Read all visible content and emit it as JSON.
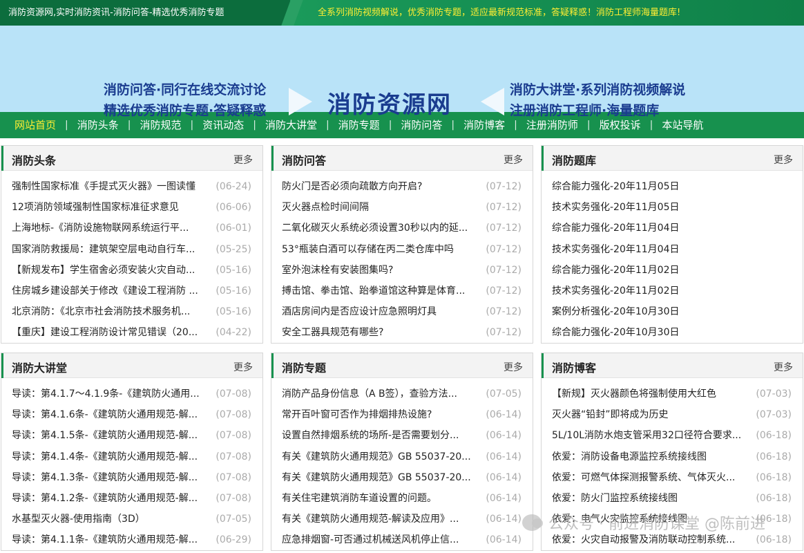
{
  "topbar": {
    "left": "消防资源网,实时消防资讯-消防问答-精选优秀消防专题",
    "right": "全系列消防视频解说，优秀消防专题，适应最新规范标准，答疑释惑！消防工程师海量题库!"
  },
  "banner": {
    "left_line1": "消防问答·同行在线交流讨论",
    "left_line2": "精选优秀消防专题·答疑释惑",
    "logo": "消防资源网",
    "right_line1": "消防大讲堂·系列消防视频解说",
    "right_line2": "注册消防工程师·海量题库"
  },
  "nav": [
    "网站首页",
    "消防头条",
    "消防规范",
    "资讯动态",
    "消防大讲堂",
    "消防专题",
    "消防问答",
    "消防博客",
    "注册消防师",
    "版权投诉",
    "本站导航"
  ],
  "more_label": "更多",
  "panels": [
    {
      "title": "消防头条",
      "items": [
        {
          "t": "强制性国家标准《手提式灭火器》一图读懂",
          "d": "(06-24)"
        },
        {
          "t": "12项消防领域强制性国家标准征求意见",
          "d": "(06-06)"
        },
        {
          "t": "上海地标-《消防设施物联网系统运行平...",
          "d": "(06-01)"
        },
        {
          "t": "国家消防救援局：建筑架空层电动自行车...",
          "d": "(05-25)"
        },
        {
          "t": "【新规发布】学生宿舍必须安装火灾自动...",
          "d": "(05-16)"
        },
        {
          "t": "住房城乡建设部关于修改《建设工程消防 ...",
          "d": "(05-16)"
        },
        {
          "t": "北京消防：《北京市社会消防技术服务机...",
          "d": "(05-16)"
        },
        {
          "t": "【重庆】建设工程消防设计常见错误（20...",
          "d": "(04-22)"
        }
      ]
    },
    {
      "title": "消防问答",
      "items": [
        {
          "t": "防火门是否必须向疏散方向开启?",
          "d": "(07-12)"
        },
        {
          "t": "灭火器点检时间间隔",
          "d": "(07-12)"
        },
        {
          "t": "二氧化碳灭火系统必须设置30秒以内的延...",
          "d": "(07-12)"
        },
        {
          "t": "53°瓶装白酒可以存储在丙二类仓库中吗",
          "d": "(07-12)"
        },
        {
          "t": "室外泡沫栓有安装图集吗?",
          "d": "(07-12)"
        },
        {
          "t": "搏击馆、拳击馆、跆拳道馆这种算是体育...",
          "d": "(07-12)"
        },
        {
          "t": "酒店房间内是否应设计应急照明灯具",
          "d": "(07-12)"
        },
        {
          "t": "安全工器具规范有哪些?",
          "d": "(07-12)"
        }
      ]
    },
    {
      "title": "消防题库",
      "items": [
        {
          "t": "综合能力强化-20年11月05日",
          "d": ""
        },
        {
          "t": "技术实务强化-20年11月05日",
          "d": ""
        },
        {
          "t": "综合能力强化-20年11月04日",
          "d": ""
        },
        {
          "t": "技术实务强化-20年11月04日",
          "d": ""
        },
        {
          "t": "综合能力强化-20年11月02日",
          "d": ""
        },
        {
          "t": "技术实务强化-20年11月02日",
          "d": ""
        },
        {
          "t": "案例分析强化-20年10月30日",
          "d": ""
        },
        {
          "t": "综合能力强化-20年10月30日",
          "d": ""
        }
      ]
    },
    {
      "title": "消防大讲堂",
      "items": [
        {
          "t": "导读：第4.1.7～4.1.9条-《建筑防火通用...",
          "d": "(07-08)"
        },
        {
          "t": "导读：第4.1.6条-《建筑防火通用规范-解...",
          "d": "(07-08)"
        },
        {
          "t": "导读：第4.1.5条-《建筑防火通用规范-解...",
          "d": "(07-08)"
        },
        {
          "t": "导读：第4.1.4条-《建筑防火通用规范-解...",
          "d": "(07-08)"
        },
        {
          "t": "导读：第4.1.3条-《建筑防火通用规范-解...",
          "d": "(07-08)"
        },
        {
          "t": "导读：第4.1.2条-《建筑防火通用规范-解...",
          "d": "(07-08)"
        },
        {
          "t": "水基型灭火器-使用指南（3D）",
          "d": "(07-05)"
        },
        {
          "t": "导读：第4.1.1条-《建筑防火通用规范-解...",
          "d": "(06-29)"
        }
      ]
    },
    {
      "title": "消防专题",
      "items": [
        {
          "t": "消防产品身份信息（A B签），查验方法...",
          "d": "(07-05)"
        },
        {
          "t": "常开百叶窗可否作为排烟排热设施?",
          "d": "(06-14)"
        },
        {
          "t": "设置自然排烟系统的场所-是否需要划分...",
          "d": "(06-14)"
        },
        {
          "t": "有关《建筑防火通用规范》GB 55037-20...",
          "d": "(06-14)"
        },
        {
          "t": "有关《建筑防火通用规范》GB 55037-20...",
          "d": "(06-14)"
        },
        {
          "t": "有关住宅建筑消防车道设置的问题。",
          "d": "(06-14)"
        },
        {
          "t": "有关《建筑防火通用规范-解读及应用》...",
          "d": "(06-14)"
        },
        {
          "t": "应急排烟窗-可否通过机械送风机停止信...",
          "d": "(06-14)"
        }
      ]
    },
    {
      "title": "消防博客",
      "items": [
        {
          "t": "【新规】灭火器颜色将强制使用大红色",
          "d": "(07-03)"
        },
        {
          "t": "灭火器“铅封”即将成为历史",
          "d": "(07-03)"
        },
        {
          "t": "5L/10L消防水炮支管采用32口径符合要求...",
          "d": "(06-18)"
        },
        {
          "t": "依爱：消防设备电源监控系统接线图",
          "d": "(06-18)"
        },
        {
          "t": "依爱：可燃气体探测报警系统、气体灭火...",
          "d": "(06-18)"
        },
        {
          "t": "依爱：防火门监控系统接线图",
          "d": "(06-18)"
        },
        {
          "t": "依爱：电气火灾监控系统接线图",
          "d": "(06-18)"
        },
        {
          "t": "依爱：火灾自动报警及消防联动控制系统...",
          "d": "(06-18)"
        }
      ]
    }
  ],
  "watermark": "公众号 · 前进消防课堂 @陈前进"
}
